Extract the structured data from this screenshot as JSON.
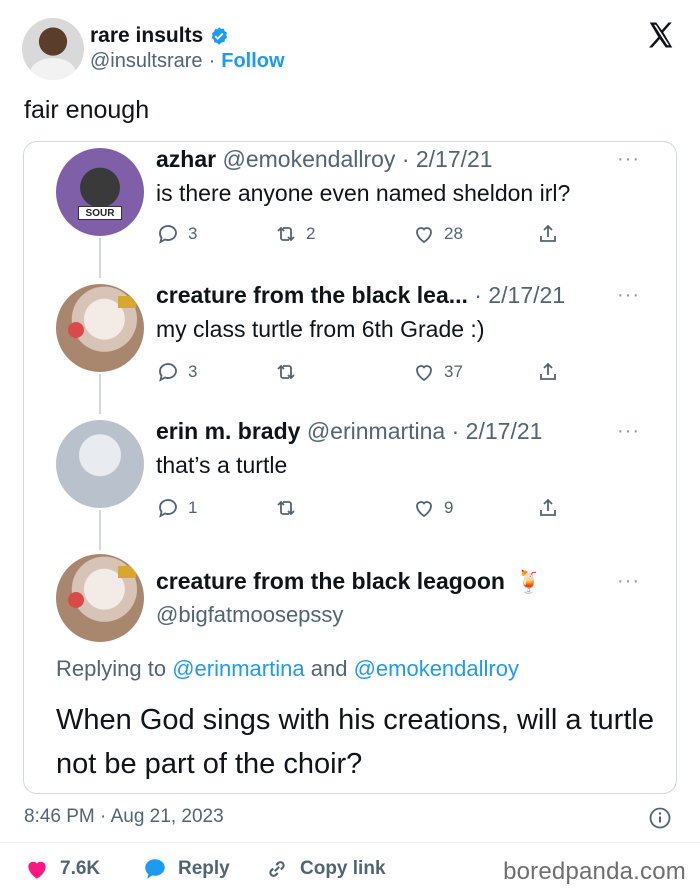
{
  "author": {
    "name": "rare insults",
    "handle": "@insultsrare",
    "separator": "·",
    "follow_label": "Follow"
  },
  "tweet": {
    "text": "fair enough",
    "timestamp": "8:46 PM · Aug 21, 2023"
  },
  "quoted_thread": {
    "replies": [
      {
        "name": "azhar",
        "handle": "@emokendallroy",
        "date": "· 2/17/21",
        "text": "is there anyone even named sheldon irl?",
        "replies": "3",
        "retweets": "2",
        "likes": "28",
        "avatar_badge": "SOUR"
      },
      {
        "name": "creature from the black lea...",
        "handle": "",
        "date": "· 2/17/21",
        "text": "my class turtle from 6th Grade :)",
        "replies": "3",
        "retweets": "",
        "likes": "37"
      },
      {
        "name": "erin m. brady",
        "handle": "@erinmartina",
        "date": "· 2/17/21",
        "text": "that’s a turtle",
        "replies": "1",
        "retweets": "",
        "likes": "9"
      }
    ],
    "final": {
      "name": "creature from the black leagoon",
      "emoji": "🍹",
      "handle": "@bigfatmoosepssy",
      "replying_prefix": "Replying to",
      "replying_user1": "@erinmartina",
      "replying_and": "and",
      "replying_user2": "@emokendallroy",
      "text": "When God sings with his creations, will a turtle not be part of the choir?"
    },
    "more_label": "···"
  },
  "footer": {
    "likes": "7.6K",
    "reply_label": "Reply",
    "copy_label": "Copy link",
    "watermark": "boredpanda.com"
  },
  "colors": {
    "accent": "#1d9bf0",
    "like": "#f91880",
    "muted": "#536471"
  }
}
